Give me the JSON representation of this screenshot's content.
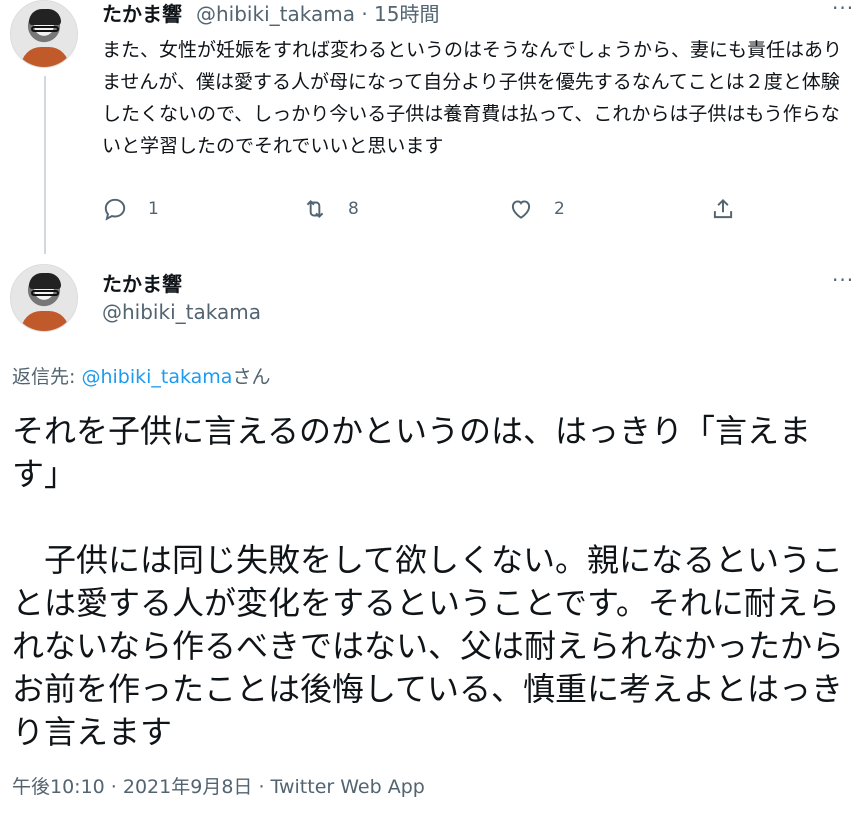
{
  "reply_tweet": {
    "name": "たかま響",
    "handle": "@hibiki_takama",
    "time": "15時間",
    "text": "また、女性が妊娠をすれば変わるというのはそうなんでしょうから、妻にも責任はありませんが、僕は愛する人が母になって自分より子供を優先するなんてことは２度と体験したくないので、しっかり今いる子供は養育費は払って、これからは子供はもう作らないと学習したのでそれでいいと思います",
    "reply_count": "1",
    "retweet_count": "8",
    "like_count": "2"
  },
  "main_tweet": {
    "name": "たかま響",
    "handle": "@hibiki_takama",
    "reply_to_label": "返信先: ",
    "reply_to_mention": "@hibiki_takama",
    "reply_to_suffix": "さん",
    "text": "それを子供に言えるのかというのは、はっきり「言えます」\n\n　子供には同じ失敗をして欲しくない。親になるということは愛する人が変化をするということです。それに耐えられないなら作るべきではない、父は耐えられなかったからお前を作ったことは後悔している、慎重に考えよとはっきり言えます",
    "meta": "午後10:10 · 2021年9月8日 · Twitter Web App"
  },
  "icons": {
    "more": "more-icon",
    "reply": "reply-icon",
    "retweet": "retweet-icon",
    "like": "like-icon",
    "share": "share-icon"
  }
}
